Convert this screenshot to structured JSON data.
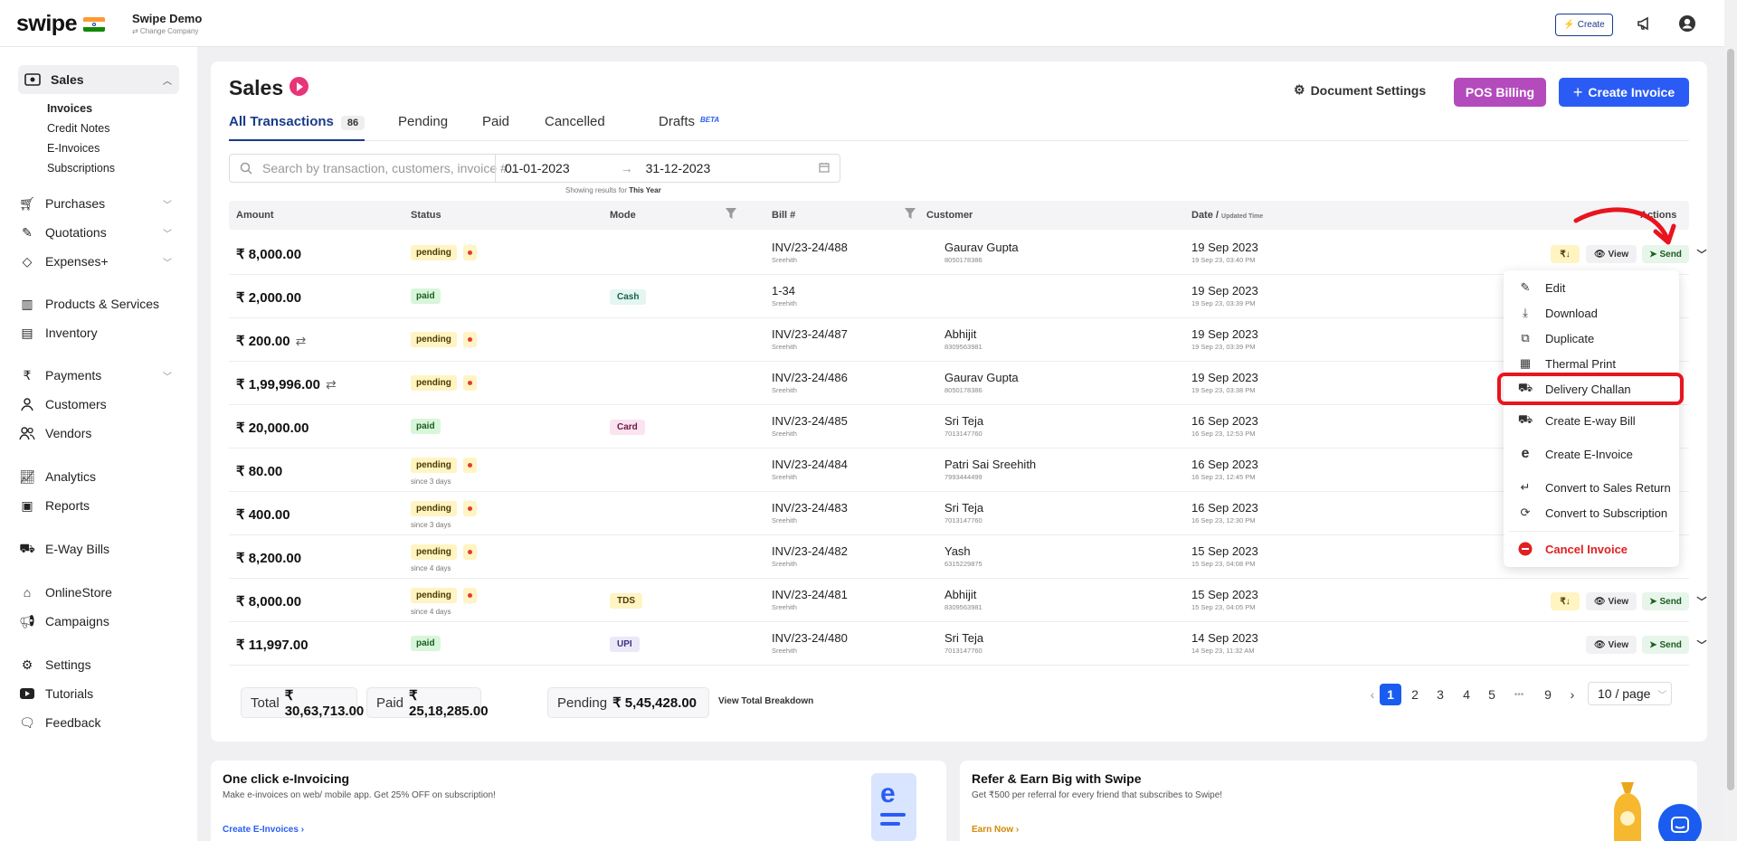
{
  "brand": {
    "logo": "swipe",
    "company": "Swipe Demo",
    "change_company": "⇄ Change Company"
  },
  "topbar": {
    "create_label": "Create"
  },
  "sidebar": {
    "sales": "Sales",
    "sales_sub": [
      "Invoices",
      "Credit Notes",
      "E-Invoices",
      "Subscriptions"
    ],
    "items": [
      "Purchases",
      "Quotations",
      "Expenses+",
      "Products & Services",
      "Inventory",
      "Payments",
      "Customers",
      "Vendors",
      "Analytics",
      "Reports",
      "E-Way Bills",
      "OnlineStore",
      "Campaigns",
      "Settings",
      "Tutorials",
      "Feedback"
    ]
  },
  "page": {
    "title": "Sales",
    "doc_settings": "Document Settings",
    "pos_billing": "POS Billing",
    "create_invoice": "Create Invoice"
  },
  "tabs": {
    "all": "All Transactions",
    "all_count": "86",
    "pending": "Pending",
    "paid": "Paid",
    "cancelled": "Cancelled",
    "drafts": "Drafts",
    "beta": "BETA"
  },
  "search": {
    "placeholder": "Search by transaction, customers, invoice #...",
    "date_from": "01-01-2023",
    "date_to": "31-12-2023",
    "hint_prefix": "Showing results for",
    "hint_value": "This Year"
  },
  "columns": {
    "amount": "Amount",
    "status": "Status",
    "mode": "Mode",
    "bill": "Bill #",
    "customer": "Customer",
    "date": "Date / ",
    "date_sub": "Updated Time",
    "actions": "Actions"
  },
  "rows": [
    {
      "amount": "₹ 8,000.00",
      "status": "pending",
      "mode": "",
      "bill": "INV/23-24/488",
      "bill_by": "Sreehith",
      "customer": "Gaurav Gupta",
      "phone": "8050178386",
      "date": "19 Sep 2023",
      "time": "19 Sep 23, 03:40 PM"
    },
    {
      "amount": "₹ 2,000.00",
      "status": "paid",
      "mode": "Cash",
      "bill": "1-34",
      "bill_by": "Sreehith",
      "customer": "",
      "phone": "",
      "date": "19 Sep 2023",
      "time": "19 Sep 23, 03:39 PM"
    },
    {
      "amount": "₹ 200.00",
      "status": "pending",
      "mode": "",
      "bill": "INV/23-24/487",
      "bill_by": "Sreehith",
      "customer": "Abhijit",
      "phone": "8309563981",
      "date": "19 Sep 2023",
      "time": "19 Sep 23, 03:39 PM"
    },
    {
      "amount": "₹ 1,99,996.00",
      "status": "pending",
      "mode": "",
      "bill": "INV/23-24/486",
      "bill_by": "Sreehith",
      "customer": "Gaurav Gupta",
      "phone": "8050178386",
      "date": "19 Sep 2023",
      "time": "19 Sep 23, 03:38 PM"
    },
    {
      "amount": "₹ 20,000.00",
      "status": "paid",
      "mode": "Card",
      "bill": "INV/23-24/485",
      "bill_by": "Sreehith",
      "customer": "Sri Teja",
      "phone": "7013147760",
      "date": "16 Sep 2023",
      "time": "16 Sep 23, 12:53 PM"
    },
    {
      "amount": "₹ 80.00",
      "status": "pending",
      "since": "since 3 days",
      "mode": "",
      "bill": "INV/23-24/484",
      "bill_by": "Sreehith",
      "customer": "Patri Sai Sreehith",
      "phone": "7993444499",
      "date": "16 Sep 2023",
      "time": "16 Sep 23, 12:45 PM"
    },
    {
      "amount": "₹ 400.00",
      "status": "pending",
      "since": "since 3 days",
      "mode": "",
      "bill": "INV/23-24/483",
      "bill_by": "Sreehith",
      "customer": "Sri Teja",
      "phone": "7013147760",
      "date": "16 Sep 2023",
      "time": "16 Sep 23, 12:30 PM"
    },
    {
      "amount": "₹ 8,200.00",
      "status": "pending",
      "since": "since 4 days",
      "mode": "",
      "bill": "INV/23-24/482",
      "bill_by": "Sreehith",
      "customer": "Yash",
      "phone": "6315229875",
      "date": "15 Sep 2023",
      "time": "15 Sep 23, 04:08 PM"
    },
    {
      "amount": "₹ 8,000.00",
      "status": "pending",
      "since": "since 4 days",
      "mode": "TDS",
      "bill": "INV/23-24/481",
      "bill_by": "Sreehith",
      "customer": "Abhijit",
      "phone": "8309563981",
      "date": "15 Sep 2023",
      "time": "15 Sep 23, 04:05 PM"
    },
    {
      "amount": "₹ 11,997.00",
      "status": "paid",
      "mode": "UPI",
      "bill": "INV/23-24/480",
      "bill_by": "Sreehith",
      "customer": "Sri Teja",
      "phone": "7013147760",
      "date": "14 Sep 2023",
      "time": "14 Sep 23, 11:32 AM"
    }
  ],
  "actions": {
    "view": "View",
    "send": "Send"
  },
  "menu": [
    "Edit",
    "Download",
    "Duplicate",
    "Thermal Print",
    "Delivery Challan",
    "Create E-way Bill",
    "Create E-Invoice",
    "Convert to Sales Return",
    "Convert to Subscription",
    "Cancel Invoice"
  ],
  "totals": {
    "total_label": "Total",
    "total": "₹ 30,63,713.00",
    "paid_label": "Paid",
    "paid": "₹ 25,18,285.00",
    "pending_label": "Pending",
    "pending": "₹ 5,45,428.00",
    "breakdown": "View Total Breakdown"
  },
  "pagination": {
    "pages": [
      "1",
      "2",
      "3",
      "4",
      "5",
      "•••",
      "9"
    ],
    "current": "1",
    "size": "10 / page"
  },
  "promos": [
    {
      "title": "One click e-Invoicing",
      "desc": "Make e-invoices on web/ mobile app. Get 25% OFF on subscription!",
      "link": "Create E-Invoices ›"
    },
    {
      "title": "Refer & Earn Big with Swipe",
      "desc": "Get ₹500 per referral for every friend that subscribes to Swipe!",
      "link": "Earn Now ›"
    }
  ],
  "colors": {
    "primary": "#2a5cf5",
    "pos": "#b44bbd",
    "pending": "#fff4c2",
    "paid": "#d8f6da",
    "danger": "#e8141e"
  }
}
